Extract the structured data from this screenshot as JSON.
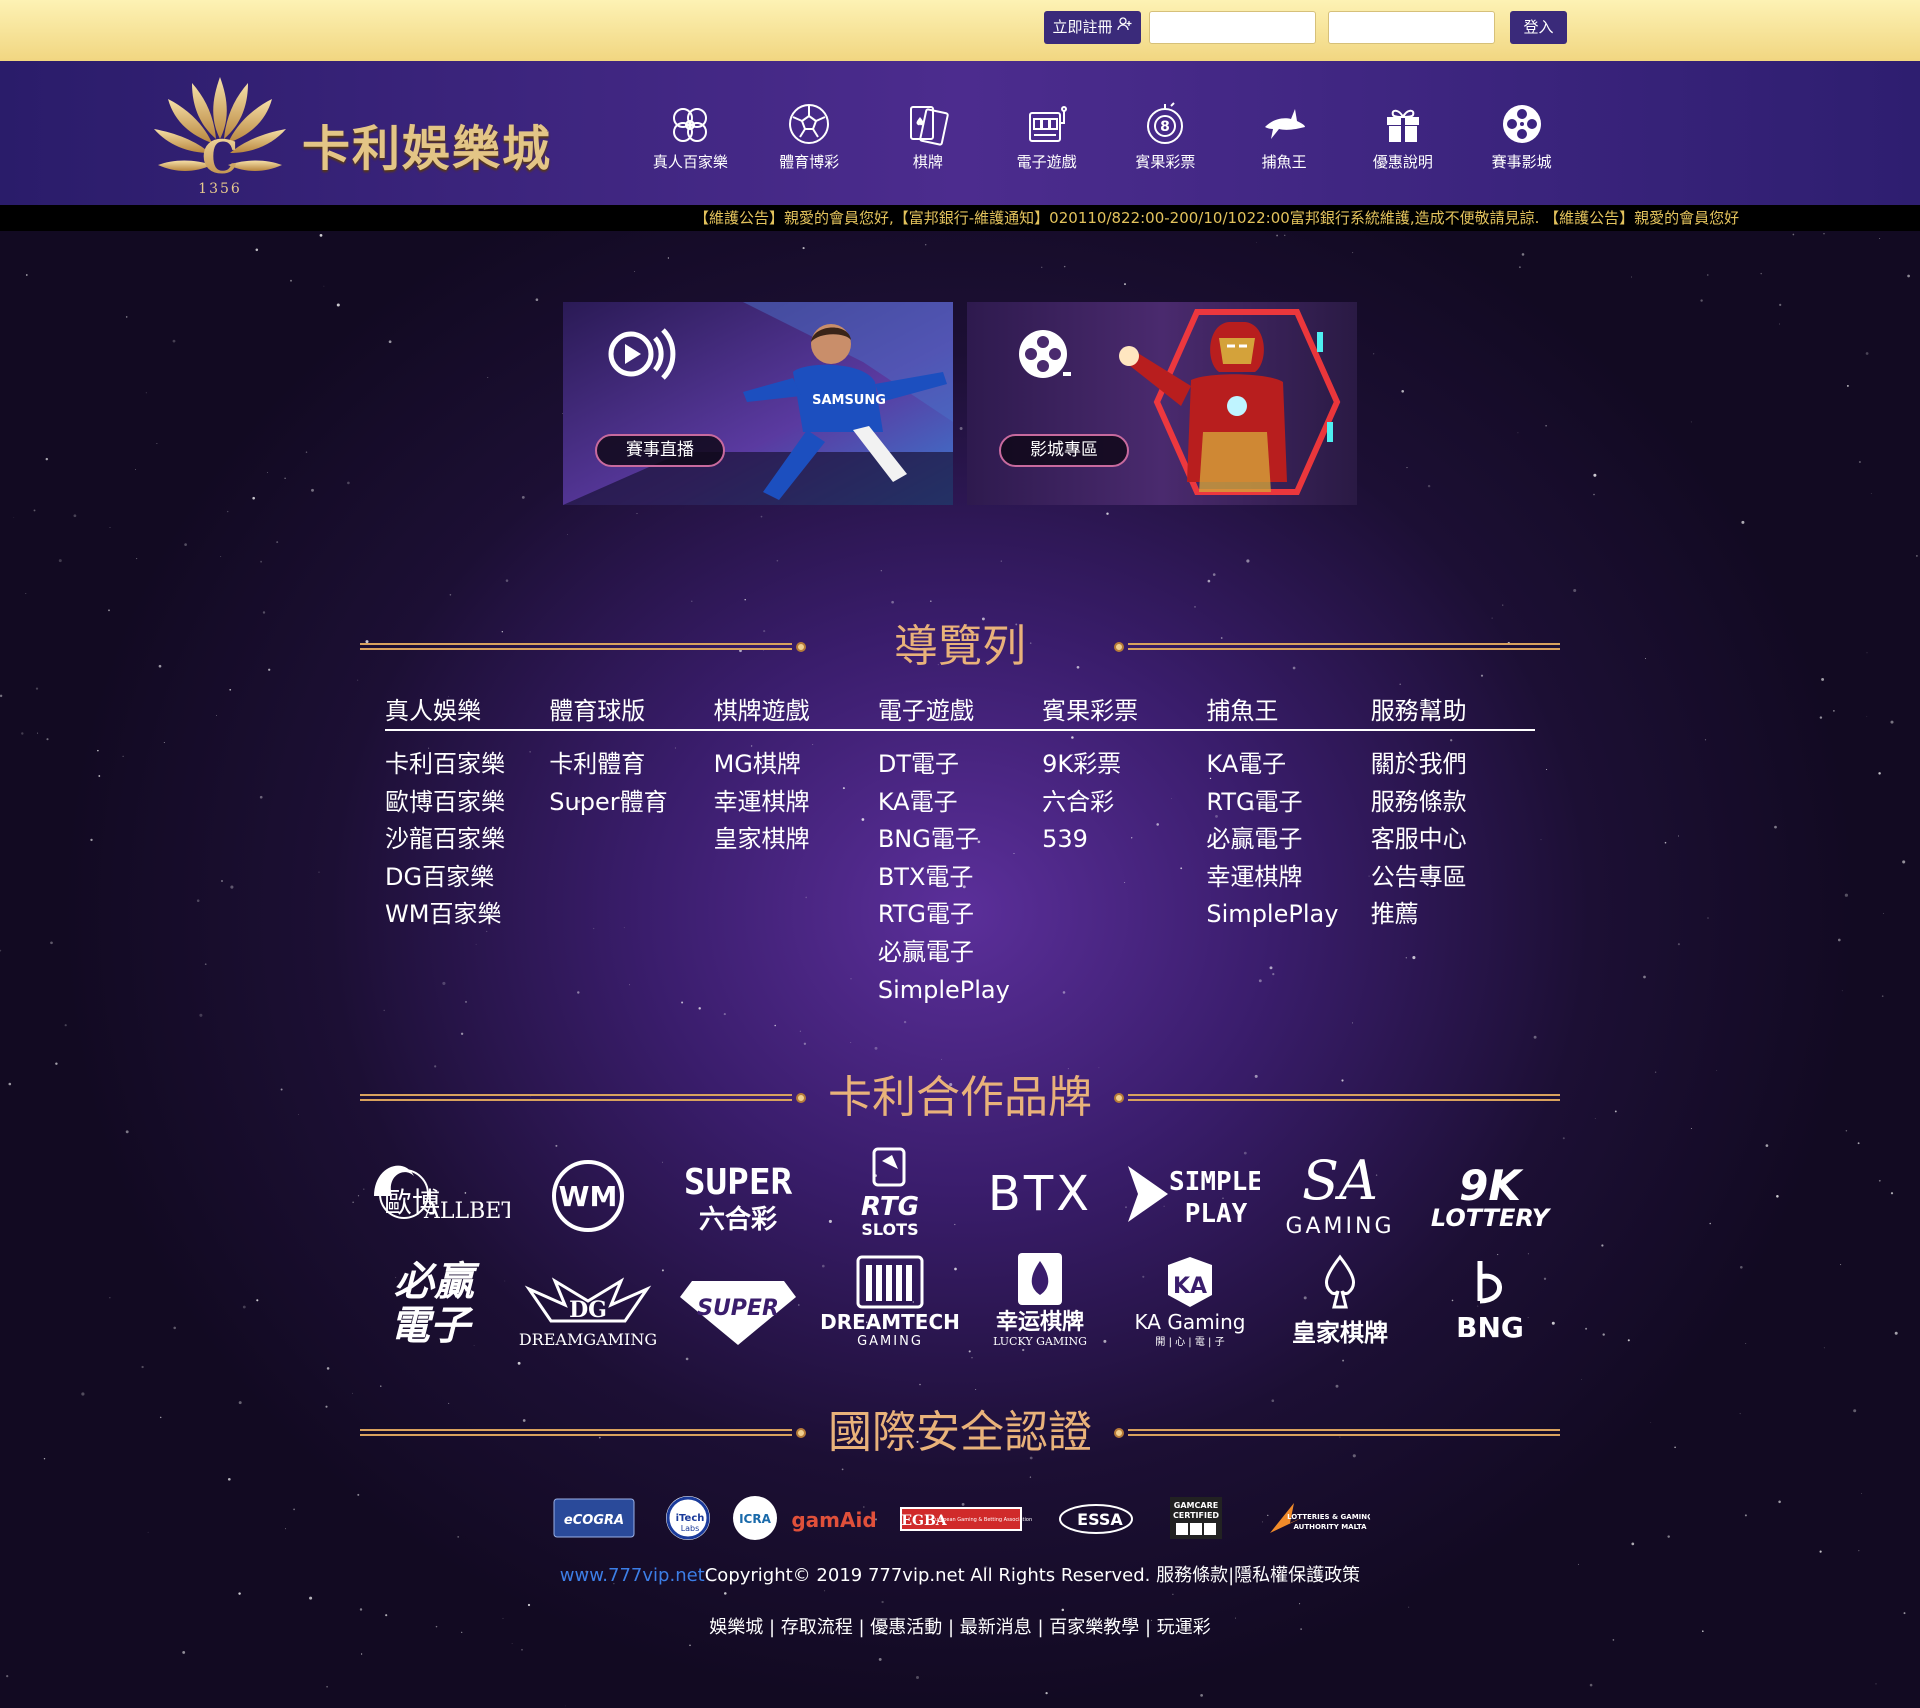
{
  "topbar": {
    "register_label": "立即註冊",
    "username_placeholder": "",
    "password_placeholder": "",
    "login_label": "登入"
  },
  "header": {
    "logo_text": "卡利娛樂城",
    "logo_number": "1356",
    "logo_letter": "C",
    "nav": [
      {
        "label": "真人百家樂",
        "icon": "baccarat-chips-icon"
      },
      {
        "label": "體育博彩",
        "icon": "soccer-ball-icon"
      },
      {
        "label": "棋牌",
        "icon": "playing-cards-icon"
      },
      {
        "label": "電子遊戲",
        "icon": "slot-machine-icon"
      },
      {
        "label": "賓果彩票",
        "icon": "lottery-ball-icon"
      },
      {
        "label": "捕魚王",
        "icon": "shark-icon"
      },
      {
        "label": "優惠說明",
        "icon": "gift-icon"
      },
      {
        "label": "賽事影城",
        "icon": "film-reel-icon"
      }
    ]
  },
  "marquee": {
    "text": "【維護公告】親愛的會員您好,【富邦銀行-維護通知】020110/822:00-200/10/1022:00富邦銀行系統維護,造成不便敬請見諒. 【維護公告】親愛的會員您好"
  },
  "promos": [
    {
      "label": "賽事直播",
      "icon": "live-stream-icon"
    },
    {
      "label": "影城專區",
      "icon": "film-reel-icon"
    }
  ],
  "directory": {
    "title": "導覽列",
    "headers": [
      "真人娛樂",
      "體育球版",
      "棋牌遊戲",
      "電子遊戲",
      "賓果彩票",
      "捕魚王",
      "服務幫助"
    ],
    "columns": [
      [
        "卡利百家樂",
        "歐博百家樂",
        "沙龍百家樂",
        "DG百家樂",
        "WM百家樂"
      ],
      [
        "卡利體育",
        "Super體育"
      ],
      [
        "MG棋牌",
        "幸運棋牌",
        "皇家棋牌"
      ],
      [
        "DT電子",
        "KA電子",
        "BNG電子",
        "BTX電子",
        "RTG電子",
        "必贏電子",
        "SimplePlay"
      ],
      [
        "9K彩票",
        "六合彩",
        "539"
      ],
      [
        "KA電子",
        "RTG電子",
        "必贏電子",
        "幸運棋牌",
        "SimplePlay"
      ],
      [
        "關於我們",
        "服務條款",
        "客服中心",
        "公告專區",
        "推薦"
      ]
    ]
  },
  "partners": {
    "title": "卡利合作品牌",
    "row1": {
      "allbet_cn": "歐博",
      "allbet": "ALLBET",
      "wm": "WM",
      "super_lotto_top": "SUPER",
      "super_lotto_bottom": "六合彩",
      "rtg_top": "RTG",
      "rtg_bottom": "SLOTS",
      "btx": "BTX",
      "simpleplay_top": "SIMPLE",
      "simpleplay_bottom": "PLAY",
      "sa_top": "SA",
      "sa_bottom": "GAMING",
      "nk_top": "9K",
      "nk_bottom": "LOTTERY"
    },
    "row2": {
      "bibei_top": "必贏",
      "bibei_bottom": "電子",
      "dg": "DREAMGAMING",
      "dg_mark": "DG",
      "super": "SUPER",
      "dreamtech_top": "DREAMTECH",
      "dreamtech_bottom": "GAMING",
      "lucky_top": "幸运棋牌",
      "lucky_bottom": "LUCKY GAMING",
      "ka_top": "KA Gaming",
      "ka_bottom": "開 | 心 | 電 | 子",
      "royal": "皇家棋牌",
      "bng": "BNG"
    }
  },
  "certs": {
    "title": "國際安全認證",
    "ecogra": "eCOGRA",
    "itech_top": "iTech",
    "itech_bottom": "Labs",
    "icra": "ICRA",
    "gamaid": "gamAid",
    "egba": "EGBA",
    "egba_sub": "European Gaming & Betting Association",
    "essa": "ESSA",
    "gamcare_top": "GAMCARE",
    "gamcare_bottom": "CERTIFIED",
    "mga_top": "LOTTERIES & GAMING",
    "mga_bottom": "AUTHORITY MALTA"
  },
  "footer": {
    "site": "www.777vip.net",
    "copyright": "Copyright© 2019 777vip.net All Rights Reserved. 服務條款|隱私權保護政策",
    "links": "娛樂城 | 存取流程 | 優惠活動 | 最新消息 | 百家樂教學 | 玩運彩"
  },
  "colors": {
    "accent_gold": "#e9b27a",
    "header_purple": "#3c2480",
    "button_purple": "#3a2a7a",
    "marquee_text": "#e2c25c",
    "footer_link": "#3c7ee6"
  }
}
